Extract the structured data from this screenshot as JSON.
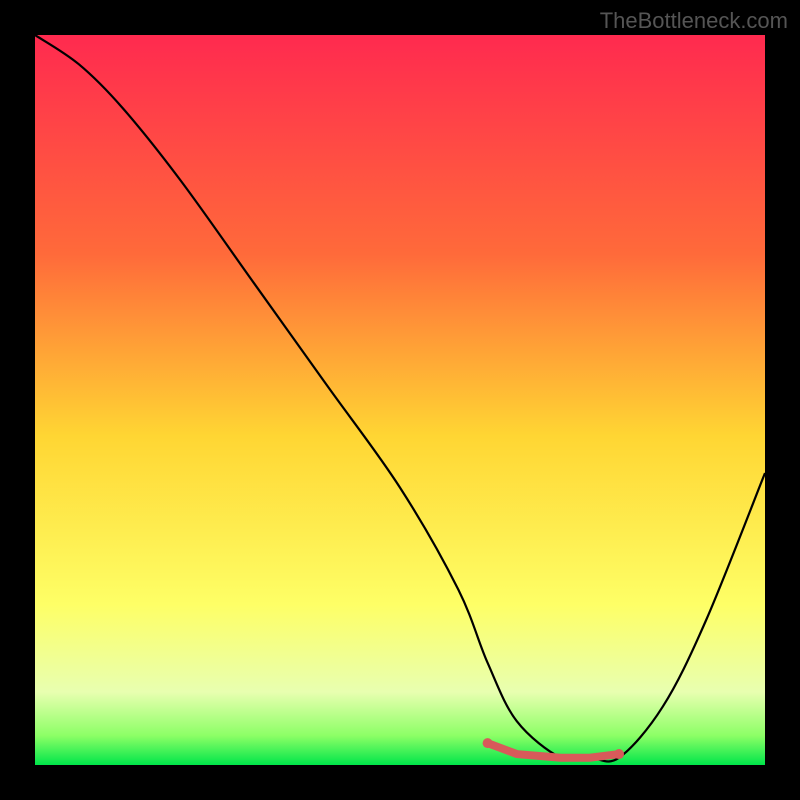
{
  "watermark": "TheBottleneck.com",
  "chart_data": {
    "type": "line",
    "title": "",
    "xlabel": "",
    "ylabel": "",
    "xlim": [
      0,
      100
    ],
    "ylim": [
      0,
      100
    ],
    "background_gradient": {
      "stops": [
        {
          "offset": 0.0,
          "color": "#ff2a4f"
        },
        {
          "offset": 0.3,
          "color": "#ff6a3a"
        },
        {
          "offset": 0.55,
          "color": "#ffd633"
        },
        {
          "offset": 0.78,
          "color": "#feff66"
        },
        {
          "offset": 0.9,
          "color": "#e8ffb0"
        },
        {
          "offset": 0.96,
          "color": "#8cff66"
        },
        {
          "offset": 1.0,
          "color": "#00e54a"
        }
      ]
    },
    "series": [
      {
        "name": "bottleneck-curve",
        "color": "#000000",
        "stroke_width": 2.2,
        "x": [
          0,
          6,
          12,
          20,
          30,
          40,
          50,
          58,
          62,
          66,
          72,
          76,
          80,
          86,
          92,
          100
        ],
        "y": [
          100,
          96,
          90,
          80,
          66,
          52,
          38,
          24,
          14,
          6,
          1,
          1,
          1,
          8,
          20,
          40
        ]
      }
    ],
    "highlight_segment": {
      "name": "optimal-range",
      "color": "#d85a5a",
      "stroke_width": 8,
      "x": [
        62,
        66,
        72,
        76,
        80
      ],
      "y": [
        3,
        1.5,
        1,
        1,
        1.5
      ],
      "endcaps": true
    }
  }
}
